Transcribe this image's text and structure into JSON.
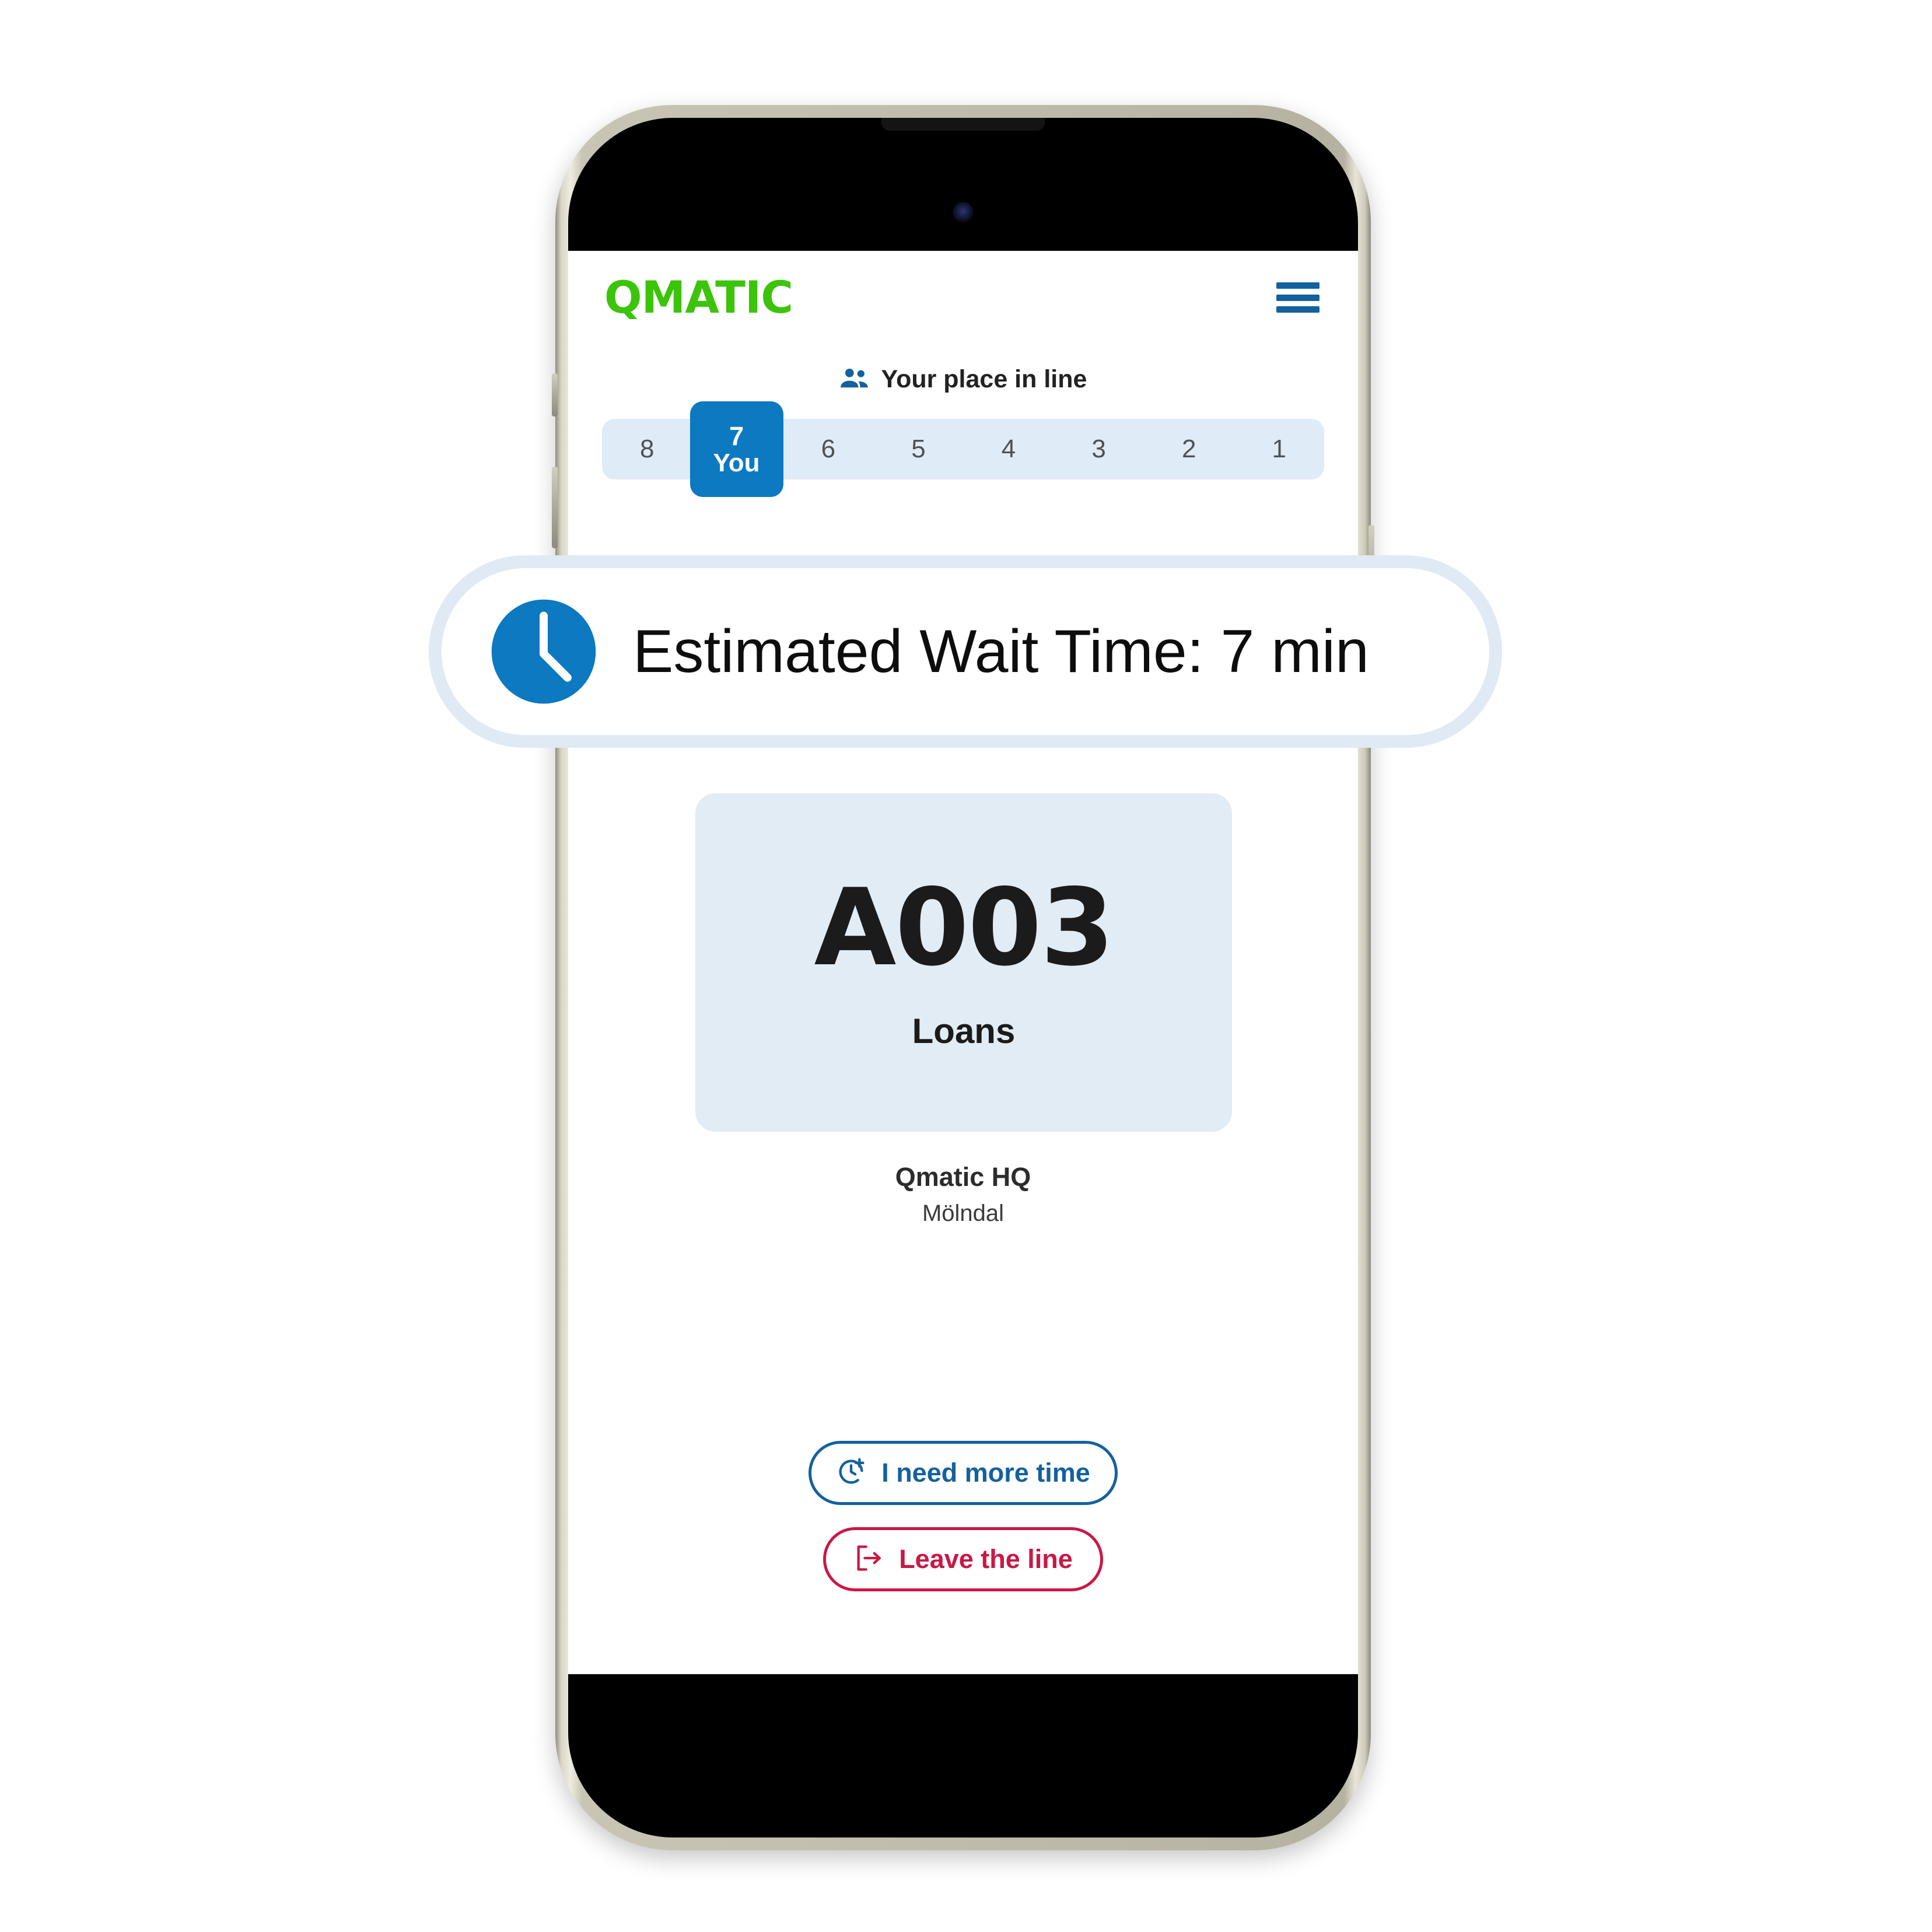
{
  "device": {
    "type": "smartphone-mockup",
    "frame_color": "#cfcbbb",
    "screen_background": "#ffffff"
  },
  "app": {
    "brand": "QMATIC",
    "brand_color": "#3cc40b",
    "accent_color": "#0c79c1",
    "danger_color": "#ca1845",
    "card_color": "#e1ecf5",
    "menu_icon": "hamburger-menu-icon"
  },
  "queue": {
    "header_icon": "people-group-icon",
    "header_label": "Your place in line",
    "strip_background": "#dfebf6",
    "positions": [
      {
        "label": "8",
        "is_you": false
      },
      {
        "label": "7",
        "is_you": true,
        "you_label": "You"
      },
      {
        "label": "6",
        "is_you": false
      },
      {
        "label": "5",
        "is_you": false
      },
      {
        "label": "4",
        "is_you": false
      },
      {
        "label": "3",
        "is_you": false
      },
      {
        "label": "2",
        "is_you": false
      },
      {
        "label": "1",
        "is_you": false
      }
    ],
    "your_position": "7"
  },
  "wait_banner": {
    "icon": "clock-icon",
    "text": "Estimated Wait Time: 7 min",
    "minutes": "7",
    "border_color": "#dfeaf4",
    "icon_color": "#0c79c1"
  },
  "ticket": {
    "number": "A003",
    "service": "Loans",
    "branch_name": "Qmatic HQ",
    "branch_city": "Mölndal"
  },
  "actions": {
    "more_time": {
      "label": "I need more time",
      "icon": "clock-plus-icon",
      "color": "#14619e"
    },
    "leave_line": {
      "label": "Leave the line",
      "icon": "logout-icon",
      "color": "#ca1845"
    }
  }
}
